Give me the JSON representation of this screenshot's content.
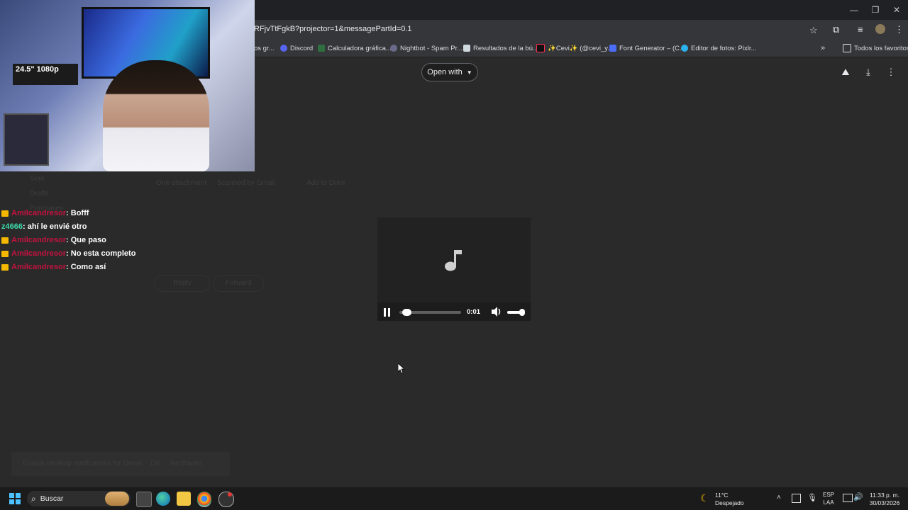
{
  "browser": {
    "url": "RFjvTtFgkB?projector=1&messagePartId=0.1",
    "bookmarks": [
      {
        "label": "os gr...",
        "color": "#777777"
      },
      {
        "label": "Discord",
        "color": "#5865f2"
      },
      {
        "label": "Calculadora gráfica...",
        "color": "#2f6f3f"
      },
      {
        "label": "Nightbot - Spam Pr...",
        "color": "#6a6a8a"
      },
      {
        "label": "Resultados de la bú...",
        "color": "#cfd8dc"
      },
      {
        "label": "✨Cevi✨ (@cevi_y...",
        "color": "#111111"
      },
      {
        "label": "Font Generator – (C...",
        "color": "#4a6cf7"
      },
      {
        "label": "Editor de fotos: Pixlr...",
        "color": "#2bb3f0"
      }
    ],
    "all_bookmarks": "Todos los favoritos"
  },
  "viewer": {
    "open_with": "Open with",
    "player": {
      "time": "0:01",
      "progress": 0.05,
      "volume": 0.85
    }
  },
  "background_ghost": {
    "attachment_text": "One attachment",
    "scanned": "Scanned by Gmail",
    "add_drive": "Add to Drive",
    "reply": "Reply",
    "forward": "Forward",
    "nav_items": [
      "Sent",
      "Drafts",
      "Purchases"
    ],
    "notification": "Enable desktop notifications for Gmail.",
    "notif_ok": "OK",
    "notif_no": "No thanks"
  },
  "chat": [
    {
      "user": "Amilcandresor",
      "message": ": Bofff",
      "crown": true,
      "color": "#c4133f"
    },
    {
      "user": "z4666",
      "message": ": ahí le envié otro",
      "crown": false,
      "color": "#3bd8a8"
    },
    {
      "user": "Amilcandresor",
      "message": ": Que paso",
      "crown": true,
      "color": "#c4133f"
    },
    {
      "user": "Amilcandresor",
      "message": ": No esta completo",
      "crown": true,
      "color": "#c4133f"
    },
    {
      "user": "Amilcandresor",
      "message": ": Como así",
      "crown": true,
      "color": "#c4133f"
    }
  ],
  "webcam": {
    "monitor_label": "24.5\" 1080p"
  },
  "taskbar": {
    "search": "Buscar",
    "weather_temp": "11°C",
    "weather_desc": "Despejado",
    "lang_top": "ESP",
    "lang_bottom": "LAA",
    "time": "11:33 p. m.",
    "date": "30/03/2026"
  }
}
